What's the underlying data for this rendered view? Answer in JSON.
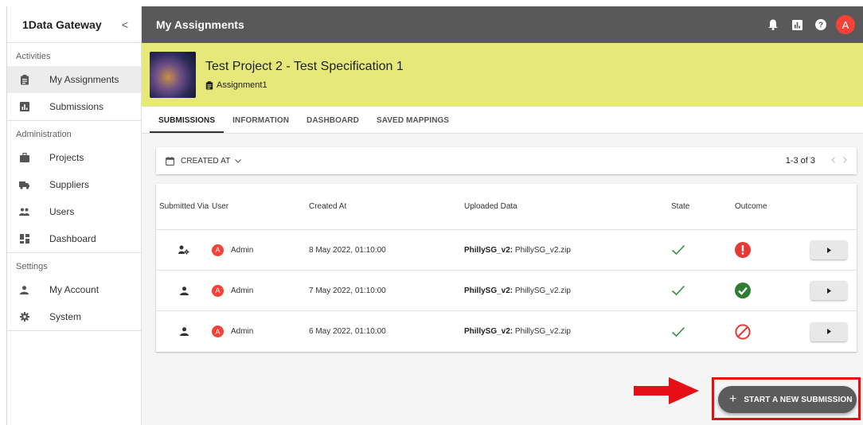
{
  "app": {
    "name": "1Data Gateway",
    "collapse_glyph": "<"
  },
  "sidebar": {
    "groups": [
      {
        "label": "Activities",
        "items": [
          {
            "label": "My Assignments",
            "icon": "clipboard-icon"
          },
          {
            "label": "Submissions",
            "icon": "bar-chart-icon"
          }
        ]
      },
      {
        "label": "Administration",
        "items": [
          {
            "label": "Projects",
            "icon": "briefcase-icon"
          },
          {
            "label": "Suppliers",
            "icon": "truck-icon"
          },
          {
            "label": "Users",
            "icon": "people-icon"
          },
          {
            "label": "Dashboard",
            "icon": "dashboard-icon"
          }
        ]
      },
      {
        "label": "Settings",
        "items": [
          {
            "label": "My Account",
            "icon": "person-icon"
          },
          {
            "label": "System",
            "icon": "gear-icon"
          }
        ]
      }
    ]
  },
  "header": {
    "title": "My Assignments",
    "avatar_letter": "A",
    "icons": [
      "bell-icon",
      "report-icon",
      "help-icon"
    ]
  },
  "project": {
    "title": "Test Project 2 - Test Specification 1",
    "assignment": "Assignment1"
  },
  "tabs": [
    "SUBMISSIONS",
    "INFORMATION",
    "DASHBOARD",
    "SAVED MAPPINGS"
  ],
  "filter": {
    "label": "CREATED AT",
    "pagination": "1-3 of 3"
  },
  "table": {
    "headers": {
      "via": "Submitted Via",
      "user": "User",
      "created": "Created At",
      "data": "Uploaded Data",
      "state": "State",
      "outcome": "Outcome"
    },
    "rows": [
      {
        "via_icon": "user-gear-icon",
        "user_letter": "A",
        "user": "Admin",
        "created": "8 May 2022, 01:10:00",
        "data_key": "PhillySG_v2:",
        "data_file": "PhillySG_v2.zip",
        "state": "check",
        "outcome": "error"
      },
      {
        "via_icon": "person-icon",
        "user_letter": "A",
        "user": "Admin",
        "created": "7 May 2022, 01:10:00",
        "data_key": "PhillySG_v2:",
        "data_file": "PhillySG_v2.zip",
        "state": "check",
        "outcome": "success"
      },
      {
        "via_icon": "person-icon",
        "user_letter": "A",
        "user": "Admin",
        "created": "6 May 2022, 01:10:00",
        "data_key": "PhillySG_v2:",
        "data_file": "PhillySG_v2.zip",
        "state": "check",
        "outcome": "cancelled"
      }
    ]
  },
  "cta": {
    "plus": "+",
    "label": "START A NEW SUBMISSION"
  },
  "colors": {
    "accent_red": "#f44336",
    "success_green": "#2e7d32",
    "check_green": "#388e3c",
    "project_bg": "#e6e87a",
    "topbar_bg": "#595959",
    "highlight_red": "#e50f15"
  }
}
